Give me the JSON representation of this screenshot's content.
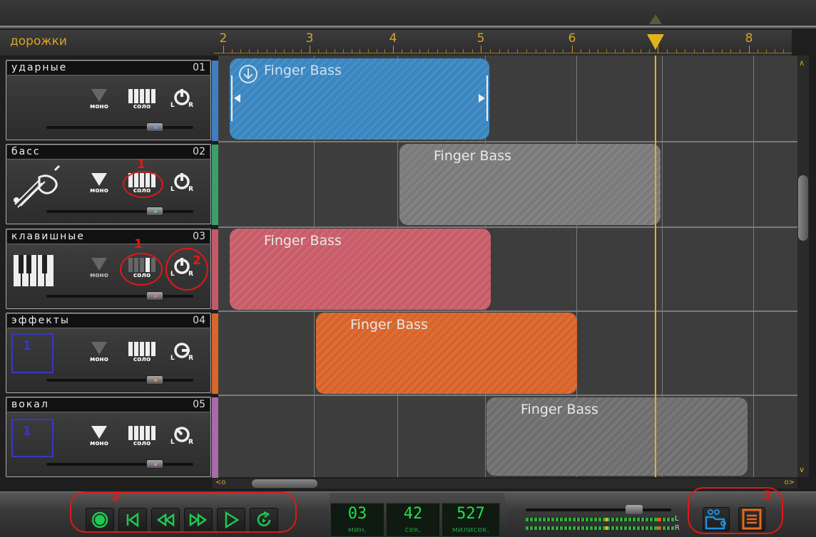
{
  "app": {
    "tracks_header": "дорожки"
  },
  "ruler": {
    "labels": [
      "2",
      "3",
      "4",
      "5",
      "6",
      "7",
      "8"
    ]
  },
  "tracks": [
    {
      "name": "ударные",
      "num": "01",
      "mono": "моно",
      "solo": "соло",
      "pan_l": "L",
      "pan_r": "R",
      "color": "#3f7fbf",
      "knob_dot": "#4fa6ff"
    },
    {
      "name": "басс",
      "num": "02",
      "mono": "моно",
      "solo": "соло",
      "pan_l": "L",
      "pan_r": "R",
      "color": "#3aa06a",
      "knob_dot": "#4fd08a"
    },
    {
      "name": "клавишные",
      "num": "03",
      "mono": "моно",
      "solo": "соло",
      "pan_l": "L",
      "pan_r": "R",
      "color": "#c35a6a",
      "knob_dot": "#ff6a7a"
    },
    {
      "name": "эффекты",
      "num": "04",
      "mono": "моно",
      "solo": "соло",
      "pan_l": "L",
      "pan_r": "R",
      "color": "#d8652a",
      "knob_dot": "#ff8a4a"
    },
    {
      "name": "вокал",
      "num": "05",
      "mono": "моно",
      "solo": "соло",
      "pan_l": "L",
      "pan_r": "R",
      "color": "#a86aa8",
      "knob_dot": "#d08ad0"
    }
  ],
  "clips": [
    {
      "title": "Finger Bass",
      "color": "#3a86c0",
      "track": 1
    },
    {
      "title": "Finger Bass",
      "color": "#7a7a7a",
      "track": 2
    },
    {
      "title": "Finger Bass",
      "color": "#c85c68",
      "track": 3
    },
    {
      "title": "Finger Bass",
      "color": "#d8642a",
      "track": 4
    },
    {
      "title": "Finger Bass",
      "color": "#6e6e6e",
      "track": 5
    }
  ],
  "clock": {
    "minutes": "03",
    "minutes_unit": "мин.",
    "seconds": "42",
    "seconds_unit": "сек.",
    "millis": "527",
    "millis_unit": "милисек."
  },
  "meter": {
    "left_label": "L",
    "right_label": "R"
  },
  "annotations": {
    "solo_bass": "1",
    "solo_keys": "1",
    "pan_keys": "2",
    "transport": "3",
    "tools": "3",
    "icon_fx": "1",
    "icon_vocal": "1"
  },
  "colors": {
    "accent": "#d8a42a",
    "playhead": "#e2b21c",
    "clock_green": "#1fe050",
    "transport_green": "#1fc850",
    "annotation_red": "#e01818",
    "annotation_blue": "#3a36c8"
  }
}
